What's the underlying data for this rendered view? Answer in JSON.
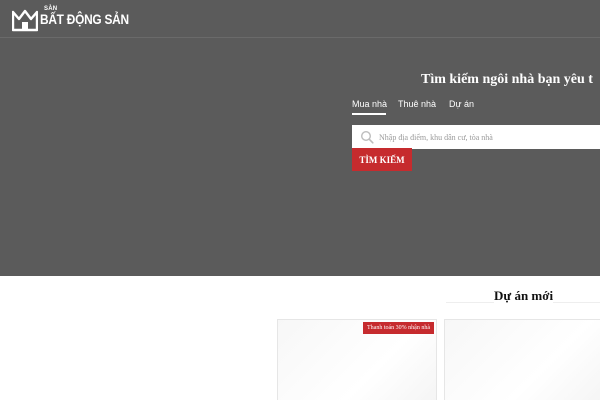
{
  "header": {
    "logo_small": "SÀN",
    "logo_big": "BẤT ĐỘNG SẢN"
  },
  "hero": {
    "title": "Tìm kiếm ngôi nhà bạn yêu t",
    "tabs": [
      {
        "label": "Mua nhà",
        "active": true
      },
      {
        "label": "Thuê nhà",
        "active": false
      },
      {
        "label": "Dự án",
        "active": false
      }
    ],
    "search": {
      "placeholder": "Nhập địa điểm, khu dân cư, tòa nhà",
      "value": "",
      "button_label": "TÌM KIẾM"
    }
  },
  "projects": {
    "title": "Dự án mới",
    "cards": [
      {
        "badge": "Thanh toán 30% nhận nhà"
      },
      {
        "badge": ""
      }
    ]
  },
  "colors": {
    "hero_bg": "#5b5b5b",
    "accent": "#c62b2e"
  }
}
